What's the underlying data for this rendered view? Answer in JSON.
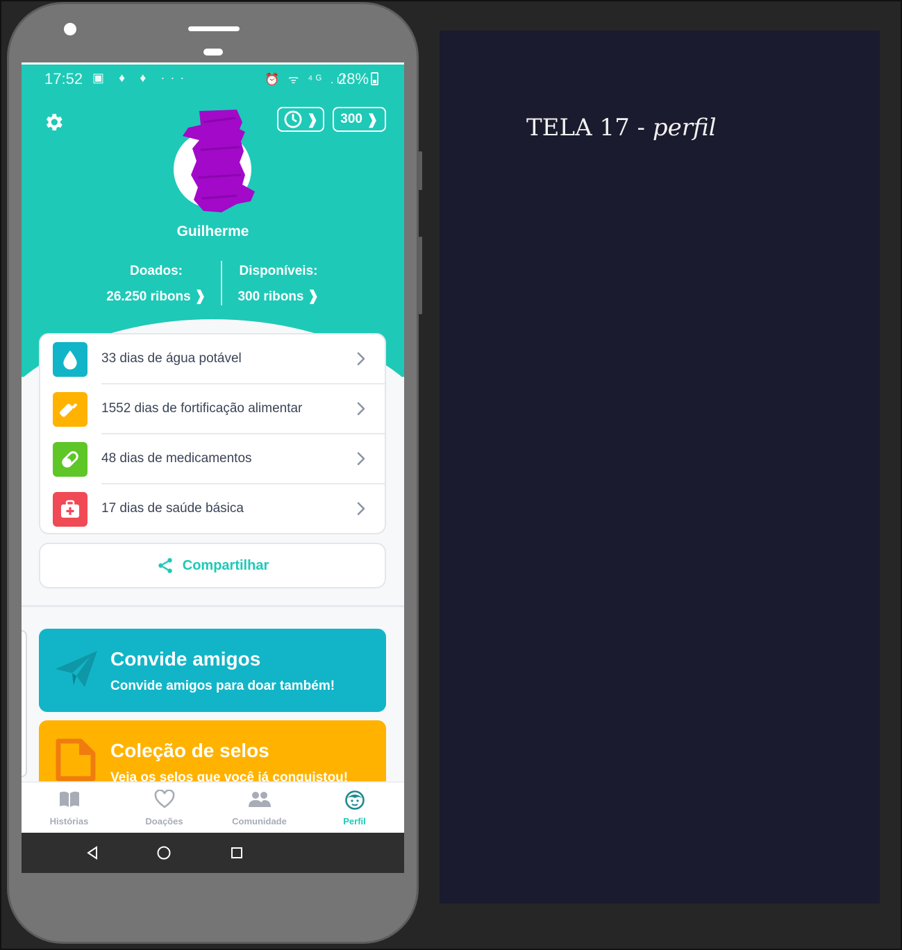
{
  "status_bar": {
    "time": "17:52",
    "left_icons": "▣ ♦ ♦ ···",
    "right_icons": "⏰ ᯤ ⁴ᴳ .ıl",
    "battery": "28%"
  },
  "header": {
    "pill_balance": "300",
    "user_name": "Guilherme",
    "donated_label": "Doados:",
    "donated_value": "26.250 ribons",
    "available_label": "Disponíveis:",
    "available_value": "300 ribons",
    "ribbon_glyph": "❱"
  },
  "impact_list": [
    {
      "label": "33 dias de água potável",
      "icon": "water-drop-icon",
      "color": "#12b5c7"
    },
    {
      "label": "1552 dias de fortificação alimentar",
      "icon": "baby-bottle-icon",
      "color": "#ffb300"
    },
    {
      "label": "48 dias de medicamentos",
      "icon": "pill-icon",
      "color": "#5ec627"
    },
    {
      "label": "17 dias de saúde básica",
      "icon": "first-aid-kit-icon",
      "color": "#ef4a55"
    }
  ],
  "share_label": "Compartilhar",
  "promos": {
    "invite_title": "Convide amigos",
    "invite_subtitle": "Convide amigos para doar também!",
    "stamps_title": "Coleção de selos",
    "stamps_subtitle": "Veja os selos que você já conquistou!"
  },
  "bottom_nav": {
    "histories": "Histórias",
    "donations": "Doações",
    "community": "Comunidade",
    "profile": "Perfil",
    "active": "profile"
  },
  "caption": {
    "prefix": "TELA 17",
    "separator": " - ",
    "name": "perfil"
  },
  "colors": {
    "brand": "#1ec9b7",
    "invite_card": "#12b5c7",
    "stamps_card": "#ffb300",
    "panel": "#1b1b2f"
  }
}
